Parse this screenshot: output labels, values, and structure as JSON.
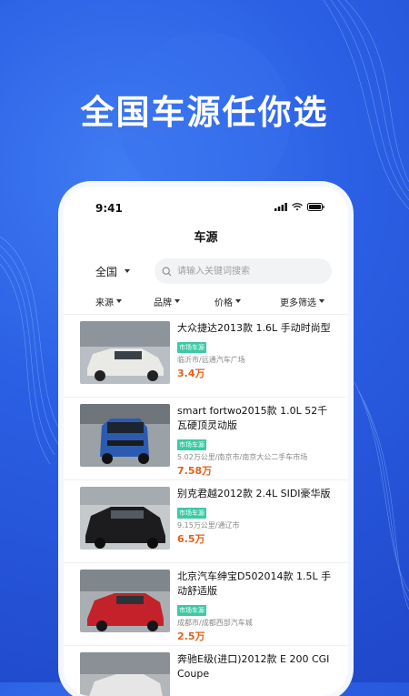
{
  "headline": "全国车源任你选",
  "status": {
    "time": "9:41"
  },
  "page_title": "车源",
  "region": "全国",
  "search": {
    "placeholder": "请输入关键词搜索"
  },
  "sort_filters": [
    "来源",
    "品牌",
    "价格",
    "更多筛选"
  ],
  "listings": [
    {
      "title": "大众捷达2013款 1.6L 手动时尚型",
      "tag": "市场车源",
      "meta": "临沂市/远通汽车广场",
      "price": "3.4万"
    },
    {
      "title": "smart fortwo2015款 1.0L 52千瓦硬顶灵动版",
      "tag": "市场车源",
      "meta": "5.02万公里/南京市/南京大公二手车市场",
      "price": "7.58万"
    },
    {
      "title": "别克君越2012款 2.4L SIDI豪华版",
      "tag": "市场车源",
      "meta": "9.15万公里/通辽市",
      "price": "6.5万"
    },
    {
      "title": "北京汽车绅宝D502014款 1.5L 手动舒适版",
      "tag": "市场车源",
      "meta": "成都市/成都西部汽车城",
      "price": "2.5万"
    },
    {
      "title": "奔驰E级(进口)2012款 E 200 CGI Coupe",
      "tag": "",
      "meta": "",
      "price": ""
    }
  ],
  "colors": {
    "background": "#2b5fe4",
    "tag": "#3cc9a6",
    "price": "#e0611a"
  }
}
